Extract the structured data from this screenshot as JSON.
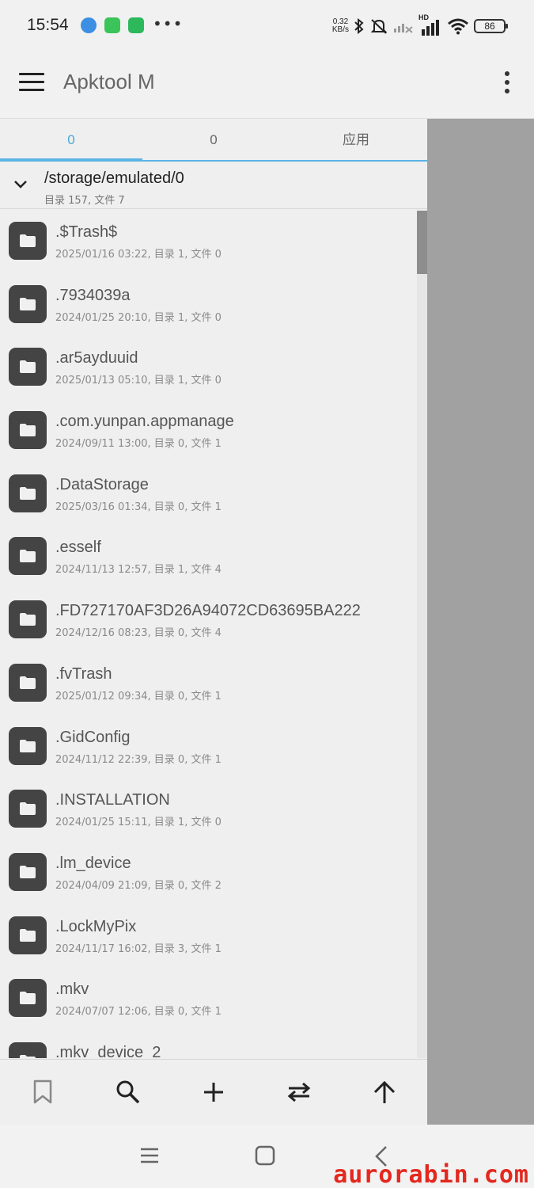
{
  "status_bar": {
    "time": "15:54",
    "net_speed_value": "0.32",
    "net_speed_unit": "KB/s",
    "network_label": "HD",
    "battery": "86"
  },
  "app_bar": {
    "title": "Apktool M",
    "menu_icon": "hamburger-menu-icon",
    "overflow_icon": "more-vert-icon"
  },
  "tabs": [
    {
      "label": "0",
      "active": true
    },
    {
      "label": "0",
      "active": false
    },
    {
      "label": "应用",
      "active": false
    }
  ],
  "path": {
    "current": "/storage/emulated/0",
    "summary": "目录 157, 文件 7"
  },
  "files": [
    {
      "name": ".$Trash$",
      "meta": "2025/01/16 03:22, 目录 1, 文件 0"
    },
    {
      "name": ".7934039a",
      "meta": "2024/01/25 20:10, 目录 1, 文件 0"
    },
    {
      "name": ".ar5ayduuid",
      "meta": "2025/01/13 05:10, 目录 1, 文件 0"
    },
    {
      "name": ".com.yunpan.appmanage",
      "meta": "2024/09/11 13:00, 目录 0, 文件 1"
    },
    {
      "name": ".DataStorage",
      "meta": "2025/03/16 01:34, 目录 0, 文件 1"
    },
    {
      "name": ".esself",
      "meta": "2024/11/13 12:57, 目录 1, 文件 4"
    },
    {
      "name": ".FD727170AF3D26A94072CD63695BA222",
      "meta": "2024/12/16 08:23, 目录 0, 文件 4"
    },
    {
      "name": ".fvTrash",
      "meta": "2025/01/12 09:34, 目录 0, 文件 1"
    },
    {
      "name": ".GidConfig",
      "meta": "2024/11/12 22:39, 目录 0, 文件 1"
    },
    {
      "name": ".INSTALLATION",
      "meta": "2024/01/25 15:11, 目录 1, 文件 0"
    },
    {
      "name": ".lm_device",
      "meta": "2024/04/09 21:09, 目录 0, 文件 2"
    },
    {
      "name": ".LockMyPix",
      "meta": "2024/11/17 16:02, 目录 3, 文件 1"
    },
    {
      "name": ".mkv",
      "meta": "2024/07/07 12:06, 目录 0, 文件 1"
    },
    {
      "name": ".mkv_device_2",
      "meta": ""
    }
  ],
  "bottom_toolbar": [
    {
      "icon": "bookmark-icon"
    },
    {
      "icon": "search-icon"
    },
    {
      "icon": "add-icon"
    },
    {
      "icon": "swap-icon"
    },
    {
      "icon": "arrow-up-icon"
    }
  ],
  "watermark": "aurorabin.com",
  "colors": {
    "accent": "#5bb4e4",
    "folder_tile": "#444444",
    "drawer_scrim": "#a1a1a1"
  }
}
